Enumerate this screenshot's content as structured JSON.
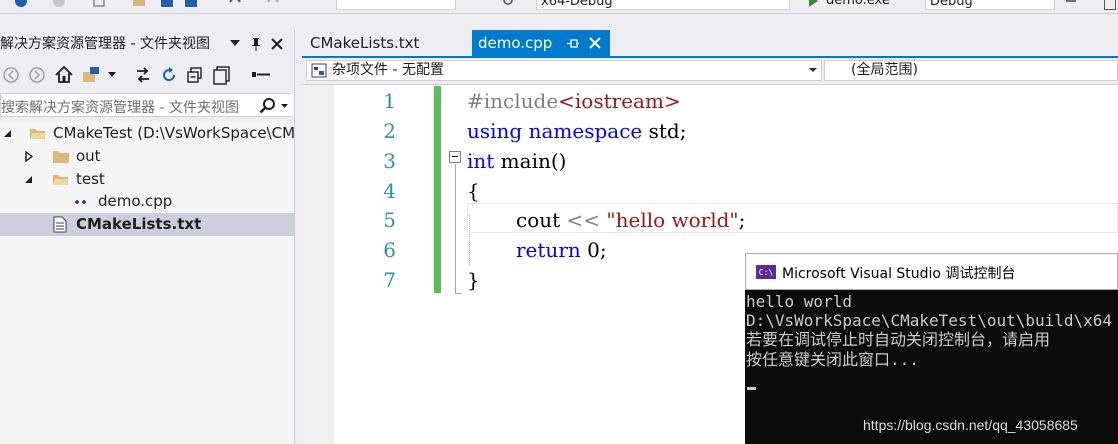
{
  "toolbar": {
    "platform": "x64-Debug",
    "startup_item": "demo.exe",
    "config": "Debug"
  },
  "solution_explorer": {
    "title": "解决方案资源管理器 - 文件夹视图",
    "search_placeholder": "搜索解决方案资源管理器 - 文件夹视图",
    "root": "CMakeTest (D:\\VsWorkSpace\\CM",
    "items": [
      {
        "label": "out",
        "kind": "folder",
        "expanded": false
      },
      {
        "label": "test",
        "kind": "folder",
        "expanded": true
      },
      {
        "label": "demo.cpp",
        "kind": "cpp-file"
      },
      {
        "label": "CMakeLists.txt",
        "kind": "text-file",
        "selected": true
      }
    ]
  },
  "tabs": [
    {
      "label": "CMakeLists.txt",
      "active": false
    },
    {
      "label": "demo.cpp",
      "active": true
    }
  ],
  "nav_bar": {
    "file_scope": "杂项文件 - 无配置",
    "global_scope": "(全局范围)"
  },
  "editor": {
    "line_numbers": [
      "1",
      "2",
      "3",
      "4",
      "5",
      "6",
      "7"
    ],
    "code": {
      "l1_directive": "#include",
      "l1_header": "<iostream>",
      "l2_using": "using",
      "l2_namespace": "namespace",
      "l2_rest": " std;",
      "l3_type": "int",
      "l3_rest": " main()",
      "l4": "{",
      "l5_cout": "cout ",
      "l5_op": "<<",
      "l5_space": " ",
      "l5_str": "\"hello world\"",
      "l5_end": ";",
      "l6_return": "return",
      "l6_rest": " 0;",
      "l7": "}"
    }
  },
  "console": {
    "title": "Microsoft Visual Studio 调试控制台",
    "icon_text": "C:\\",
    "lines": [
      "hello world",
      "D:\\VsWorkSpace\\CMakeTest\\out\\build\\x64",
      "若要在调试停止时自动关闭控制台，请启用",
      "按任意键关闭此窗口..."
    ]
  },
  "watermark": "https://blog.csdn.net/qq_43058685",
  "colors": {
    "accent": "#007acc",
    "keyword": "#0000ff",
    "string": "#a31515",
    "line_number": "#2b91af",
    "change_bar": "#57c05a"
  }
}
